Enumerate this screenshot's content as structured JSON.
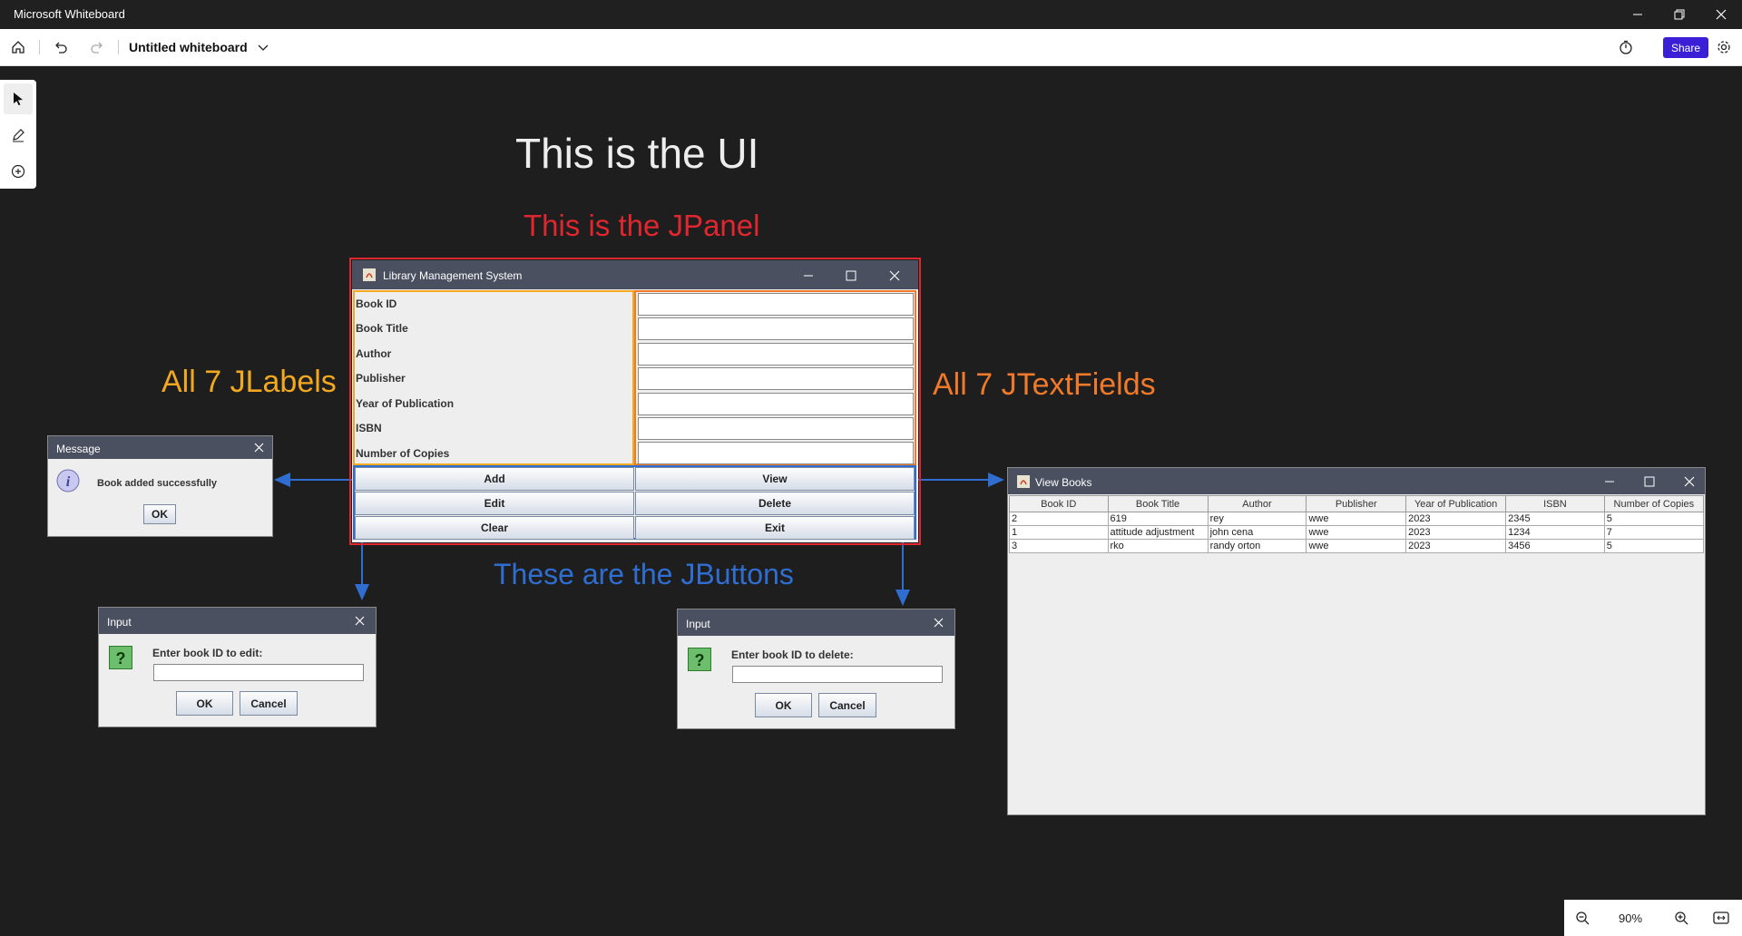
{
  "app": {
    "title": "Microsoft Whiteboard"
  },
  "toolbar": {
    "board_title": "Untitled whiteboard",
    "share_label": "Share"
  },
  "zoom": {
    "level": "90%"
  },
  "annotations": {
    "ui_title": "This is the UI",
    "jpanel": "This is the JPanel",
    "jlabels": "All 7 JLabels",
    "jtextfields": "All 7 JTextFields",
    "jbuttons": "These are the JButtons"
  },
  "colors": {
    "red": "#e0262e",
    "yellow": "#f2a91f",
    "orange": "#f07a2a",
    "blue": "#2f6ed0",
    "share": "#3b1fd6"
  },
  "main_window": {
    "title": "Library Management System",
    "labels": [
      "Book ID",
      "Book Title",
      "Author",
      "Publisher",
      "Year of Publication",
      "ISBN",
      "Number of Copies"
    ],
    "buttons": [
      "Add",
      "View",
      "Edit",
      "Delete",
      "Clear",
      "Exit"
    ]
  },
  "message_dialog": {
    "title": "Message",
    "text": "Book added successfully",
    "ok": "OK"
  },
  "edit_dialog": {
    "title": "Input",
    "prompt": "Enter book ID to edit:",
    "ok": "OK",
    "cancel": "Cancel"
  },
  "delete_dialog": {
    "title": "Input",
    "prompt": "Enter book ID to delete:",
    "ok": "OK",
    "cancel": "Cancel"
  },
  "view_window": {
    "title": "View Books",
    "columns": [
      "Book ID",
      "Book Title",
      "Author",
      "Publisher",
      "Year of Publication",
      "ISBN",
      "Number of Copies"
    ],
    "rows": [
      [
        "2",
        "619",
        "rey",
        "wwe",
        "2023",
        "2345",
        "5"
      ],
      [
        "1",
        "attitude adjustment",
        "john cena",
        "wwe",
        "2023",
        "1234",
        "7"
      ],
      [
        "3",
        "rko",
        "randy orton",
        "wwe",
        "2023",
        "3456",
        "5"
      ]
    ]
  }
}
